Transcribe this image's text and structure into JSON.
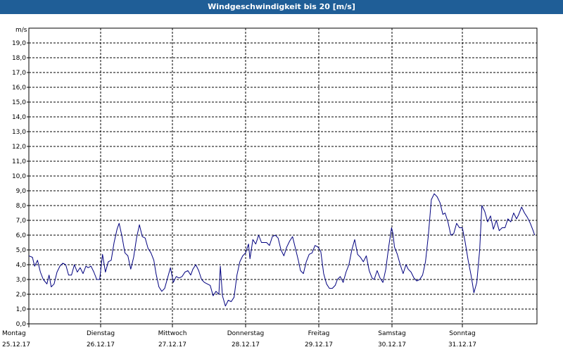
{
  "window": {
    "title": "Windgeschwindigkeit bis 20 [m/s]"
  },
  "chart_data": {
    "type": "line",
    "title": "Windgeschwindigkeit bis 20 [m/s]",
    "ylabel": "m/s",
    "ylim": [
      0,
      20
    ],
    "grid": true,
    "y_ticks": [
      "0,0",
      "1,0",
      "2,0",
      "3,0",
      "4,0",
      "5,0",
      "6,0",
      "7,0",
      "8,0",
      "9,0",
      "10,0",
      "11,0",
      "12,0",
      "13,0",
      "14,0",
      "15,0",
      "16,0",
      "17,0",
      "18,0",
      "19,0"
    ],
    "x_ticks": [
      {
        "day": "Montag",
        "date": "25.12.17"
      },
      {
        "day": "Dienstag",
        "date": "26.12.17"
      },
      {
        "day": "Mittwoch",
        "date": "27.12.17"
      },
      {
        "day": "Donnerstag",
        "date": "28.12.17"
      },
      {
        "day": "Freitag",
        "date": "29.12.17"
      },
      {
        "day": "Samstag",
        "date": "30.12.17"
      },
      {
        "day": "Sonntag",
        "date": "31.12.17"
      }
    ],
    "series": [
      {
        "color": "#00007f",
        "x_unit": "days since Montag 25.12.17 00:00",
        "points": [
          [
            0.0,
            4.6
          ],
          [
            0.05,
            4.5
          ],
          [
            0.08,
            3.9
          ],
          [
            0.12,
            4.3
          ],
          [
            0.16,
            3.5
          ],
          [
            0.2,
            3.0
          ],
          [
            0.25,
            2.7
          ],
          [
            0.28,
            3.3
          ],
          [
            0.31,
            2.5
          ],
          [
            0.35,
            2.7
          ],
          [
            0.39,
            3.5
          ],
          [
            0.43,
            3.9
          ],
          [
            0.47,
            4.1
          ],
          [
            0.51,
            4.0
          ],
          [
            0.55,
            3.3
          ],
          [
            0.59,
            3.3
          ],
          [
            0.63,
            4.0
          ],
          [
            0.67,
            3.5
          ],
          [
            0.71,
            3.8
          ],
          [
            0.75,
            3.4
          ],
          [
            0.79,
            3.9
          ],
          [
            0.82,
            3.8
          ],
          [
            0.86,
            3.9
          ],
          [
            0.9,
            3.5
          ],
          [
            0.94,
            3.0
          ],
          [
            0.98,
            3.0
          ],
          [
            1.02,
            4.7
          ],
          [
            1.06,
            3.5
          ],
          [
            1.1,
            4.2
          ],
          [
            1.14,
            4.3
          ],
          [
            1.18,
            5.5
          ],
          [
            1.22,
            6.4
          ],
          [
            1.25,
            6.8
          ],
          [
            1.29,
            5.9
          ],
          [
            1.33,
            4.8
          ],
          [
            1.37,
            4.6
          ],
          [
            1.41,
            3.7
          ],
          [
            1.45,
            4.5
          ],
          [
            1.49,
            5.8
          ],
          [
            1.53,
            6.7
          ],
          [
            1.57,
            5.9
          ],
          [
            1.61,
            5.8
          ],
          [
            1.65,
            5.1
          ],
          [
            1.69,
            4.8
          ],
          [
            1.73,
            4.3
          ],
          [
            1.76,
            3.4
          ],
          [
            1.8,
            2.5
          ],
          [
            1.84,
            2.2
          ],
          [
            1.88,
            2.4
          ],
          [
            1.92,
            3.1
          ],
          [
            1.96,
            3.8
          ],
          [
            2.0,
            2.8
          ],
          [
            2.04,
            3.2
          ],
          [
            2.08,
            3.1
          ],
          [
            2.12,
            3.2
          ],
          [
            2.16,
            3.5
          ],
          [
            2.2,
            3.6
          ],
          [
            2.24,
            3.3
          ],
          [
            2.27,
            3.7
          ],
          [
            2.31,
            4.0
          ],
          [
            2.35,
            3.6
          ],
          [
            2.39,
            3.0
          ],
          [
            2.43,
            2.8
          ],
          [
            2.47,
            2.7
          ],
          [
            2.51,
            2.6
          ],
          [
            2.55,
            1.9
          ],
          [
            2.59,
            2.2
          ],
          [
            2.63,
            2.0
          ],
          [
            2.65,
            3.9
          ],
          [
            2.68,
            1.9
          ],
          [
            2.72,
            1.2
          ],
          [
            2.76,
            1.6
          ],
          [
            2.8,
            1.5
          ],
          [
            2.84,
            1.8
          ],
          [
            2.88,
            3.3
          ],
          [
            2.92,
            4.2
          ],
          [
            2.96,
            4.6
          ],
          [
            3.0,
            4.8
          ],
          [
            3.04,
            5.4
          ],
          [
            3.06,
            4.4
          ],
          [
            3.1,
            5.7
          ],
          [
            3.14,
            5.4
          ],
          [
            3.18,
            6.0
          ],
          [
            3.22,
            5.5
          ],
          [
            3.25,
            5.5
          ],
          [
            3.29,
            5.5
          ],
          [
            3.33,
            5.3
          ],
          [
            3.37,
            5.9
          ],
          [
            3.41,
            6.0
          ],
          [
            3.45,
            5.8
          ],
          [
            3.49,
            5.0
          ],
          [
            3.53,
            4.6
          ],
          [
            3.57,
            5.2
          ],
          [
            3.61,
            5.6
          ],
          [
            3.65,
            5.9
          ],
          [
            3.69,
            5.1
          ],
          [
            3.73,
            4.3
          ],
          [
            3.76,
            3.6
          ],
          [
            3.8,
            3.4
          ],
          [
            3.84,
            4.2
          ],
          [
            3.88,
            4.7
          ],
          [
            3.92,
            4.8
          ],
          [
            3.96,
            5.3
          ],
          [
            4.0,
            5.2
          ],
          [
            4.04,
            4.9
          ],
          [
            4.08,
            3.4
          ],
          [
            4.12,
            2.7
          ],
          [
            4.16,
            2.4
          ],
          [
            4.2,
            2.4
          ],
          [
            4.24,
            2.6
          ],
          [
            4.27,
            3.0
          ],
          [
            4.31,
            3.2
          ],
          [
            4.35,
            2.8
          ],
          [
            4.39,
            3.5
          ],
          [
            4.43,
            4.0
          ],
          [
            4.47,
            5.0
          ],
          [
            4.51,
            5.7
          ],
          [
            4.55,
            4.7
          ],
          [
            4.59,
            4.5
          ],
          [
            4.63,
            4.2
          ],
          [
            4.67,
            4.6
          ],
          [
            4.71,
            3.6
          ],
          [
            4.75,
            3.1
          ],
          [
            4.78,
            3.0
          ],
          [
            4.82,
            3.6
          ],
          [
            4.86,
            3.1
          ],
          [
            4.9,
            2.8
          ],
          [
            4.94,
            3.7
          ],
          [
            4.98,
            5.2
          ],
          [
            5.02,
            6.5
          ],
          [
            5.04,
            6.1
          ],
          [
            5.06,
            5.2
          ],
          [
            5.1,
            4.7
          ],
          [
            5.14,
            4.0
          ],
          [
            5.18,
            3.4
          ],
          [
            5.22,
            4.0
          ],
          [
            5.25,
            3.7
          ],
          [
            5.29,
            3.5
          ],
          [
            5.33,
            3.1
          ],
          [
            5.37,
            2.9
          ],
          [
            5.41,
            3.0
          ],
          [
            5.45,
            3.3
          ],
          [
            5.49,
            4.2
          ],
          [
            5.53,
            6.0
          ],
          [
            5.57,
            8.4
          ],
          [
            5.61,
            8.8
          ],
          [
            5.65,
            8.6
          ],
          [
            5.69,
            8.2
          ],
          [
            5.73,
            7.4
          ],
          [
            5.76,
            7.5
          ],
          [
            5.8,
            6.9
          ],
          [
            5.84,
            6.0
          ],
          [
            5.88,
            6.1
          ],
          [
            5.92,
            6.8
          ],
          [
            5.96,
            6.5
          ],
          [
            6.0,
            6.5
          ],
          [
            6.04,
            5.5
          ],
          [
            6.08,
            4.3
          ],
          [
            6.12,
            3.3
          ],
          [
            6.14,
            2.7
          ],
          [
            6.16,
            2.1
          ],
          [
            6.2,
            2.8
          ],
          [
            6.24,
            5.0
          ],
          [
            6.27,
            8.0
          ],
          [
            6.31,
            7.6
          ],
          [
            6.35,
            6.9
          ],
          [
            6.39,
            7.3
          ],
          [
            6.43,
            6.4
          ],
          [
            6.47,
            7.0
          ],
          [
            6.51,
            6.3
          ],
          [
            6.55,
            6.5
          ],
          [
            6.59,
            6.5
          ],
          [
            6.63,
            7.1
          ],
          [
            6.67,
            6.9
          ],
          [
            6.71,
            7.5
          ],
          [
            6.75,
            7.1
          ],
          [
            6.78,
            7.4
          ],
          [
            6.82,
            7.9
          ],
          [
            6.86,
            7.5
          ],
          [
            6.9,
            7.2
          ],
          [
            6.94,
            6.8
          ],
          [
            6.98,
            6.3
          ],
          [
            7.0,
            6.0
          ]
        ]
      }
    ]
  }
}
